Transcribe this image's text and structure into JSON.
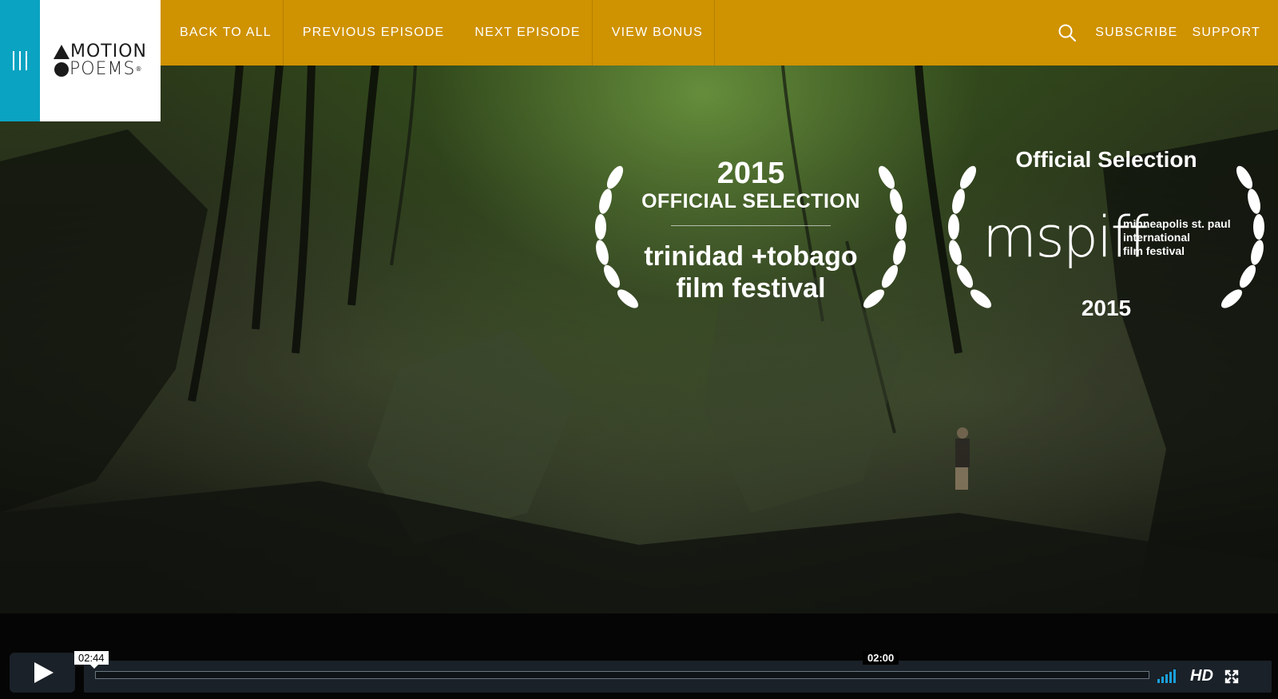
{
  "nav": {
    "menu_icon": "hamburger-icon",
    "logo": {
      "line1": "MOTION",
      "line2": "POEMS",
      "mark": "®"
    },
    "links": [
      {
        "label": "BACK TO ALL"
      },
      {
        "label": "PREVIOUS EPISODE"
      },
      {
        "label": "NEXT EPISODE"
      },
      {
        "label": "VIEW BONUS"
      }
    ],
    "search_icon": "search-icon",
    "subscribe_label": "SUBSCRIBE",
    "support_label": "SUPPORT",
    "colors": {
      "bar": "#cf9200",
      "menu": "#0aa3c2",
      "logo_bg": "#ffffff"
    }
  },
  "video": {
    "laurel_1": {
      "year": "2015",
      "selection": "OFFICIAL SELECTION",
      "festival_line1": "trinidad +tobago",
      "festival_line2": "film festival"
    },
    "laurel_2": {
      "selection": "Official Selection",
      "brand": "mspiff",
      "brand_sub_1": "minneapolis st. paul",
      "brand_sub_2": "international",
      "brand_sub_3": "film festival",
      "year": "2015"
    }
  },
  "player": {
    "play_icon": "play-icon",
    "duration": "02:44",
    "hover_time": "02:00",
    "progress": 0.0,
    "volume_icon": "volume-icon",
    "hd_label": "HD",
    "fullscreen_icon": "fullscreen-icon",
    "colors": {
      "bar": "#1a2128",
      "accent": "#1a9fd9"
    }
  }
}
